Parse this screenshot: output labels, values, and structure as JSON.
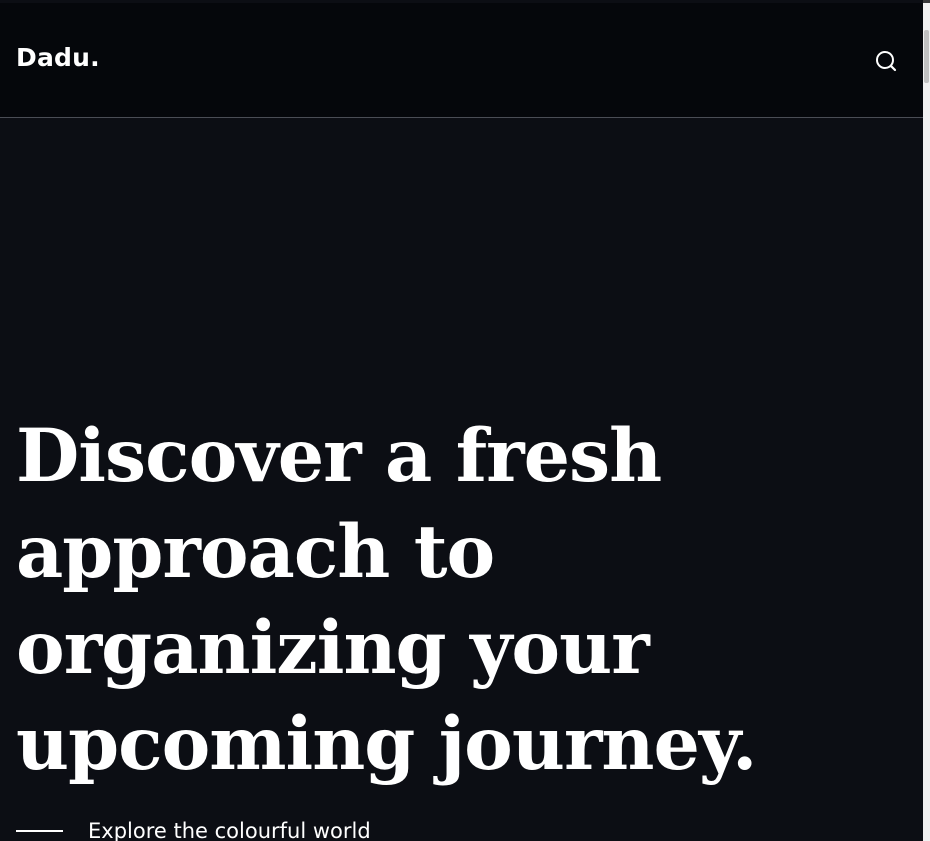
{
  "header": {
    "logo": "Dadu.",
    "search_icon": "search-icon"
  },
  "hero": {
    "title": "Discover a fresh approach to organizing your upcoming journey.",
    "tagline": "Explore the colourful world"
  },
  "colors": {
    "background": "#0c0e14",
    "header_background": "#05070b",
    "text": "#ffffff"
  }
}
